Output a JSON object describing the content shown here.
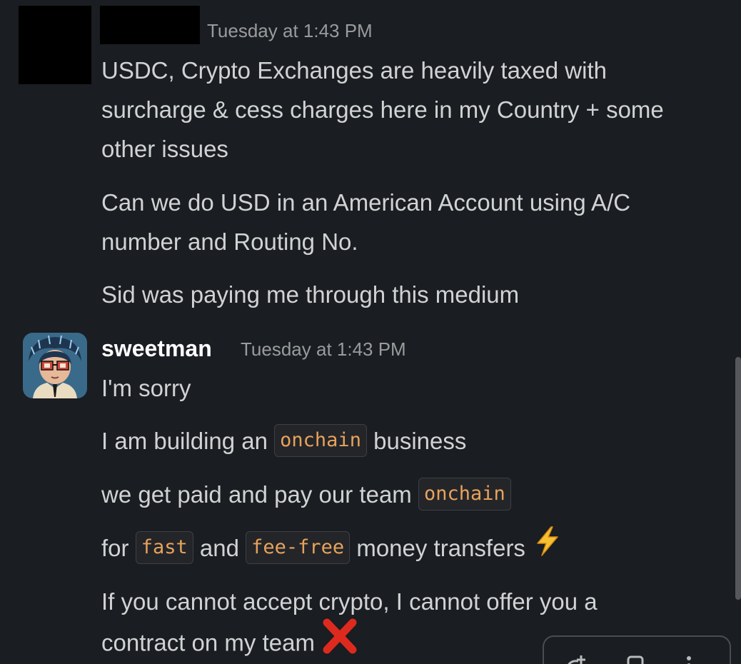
{
  "message1": {
    "timestamp": "Tuesday at 1:43 PM",
    "paragraph1_line1": "USDC, Crypto Exchanges are heavily taxed with",
    "paragraph1_line2": "surcharge & cess charges here in my Country + some",
    "paragraph1_line3": "other issues",
    "paragraph2_line1": "Can we do USD in an American Account using A/C",
    "paragraph2_line2": "number and Routing No.",
    "paragraph3": "Sid was paying me through this medium"
  },
  "message2": {
    "username": "sweetman",
    "timestamp": "Tuesday at 1:43 PM",
    "line1": "I'm sorry",
    "line2_before": "I am building an",
    "line2_code": "onchain",
    "line2_after": "business",
    "line3_before": "we get paid and pay our team",
    "line3_code": "onchain",
    "line4_before": "for",
    "line4_code1": "fast",
    "line4_mid": "and",
    "line4_code2": "fee-free",
    "line4_after": "money transfers",
    "line5_line1": "If you cannot accept crypto, I cannot offer you a",
    "line5_line2": "contract on my team"
  },
  "icons": {
    "bolt": "high-voltage-emoji",
    "cross": "cross-mark-emoji"
  },
  "colors": {
    "background": "#1a1d21",
    "text": "#d1d2d3",
    "code_text": "#e8a25c",
    "timestamp": "#9a9b9e"
  }
}
